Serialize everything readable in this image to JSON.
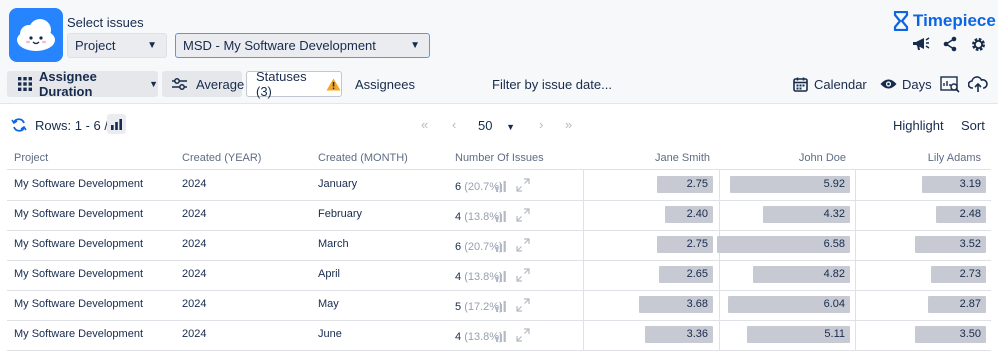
{
  "header": {
    "select_label": "Select issues",
    "scope_select": "Project",
    "project_select": "MSD - My Software Development",
    "brand": "Timepiece"
  },
  "toolbar": {
    "report_type": "Assignee Duration",
    "average": "Average",
    "statuses": "Statuses (3)",
    "assignees": "Assignees",
    "filter_date": "Filter by issue date...",
    "calendar": "Calendar",
    "days": "Days"
  },
  "table_controls": {
    "rows_label": "Rows: 1 - 6 / 6",
    "page_size": "50",
    "highlight": "Highlight",
    "sort": "Sort"
  },
  "columns": [
    "Project",
    "Created (YEAR)",
    "Created (MONTH)",
    "Number Of Issues",
    "Jane Smith",
    "John Doe",
    "Lily Adams"
  ],
  "rows": [
    {
      "project": "My Software Development",
      "year": "2024",
      "month": "January",
      "issues": "6",
      "pct": "(20.7%)",
      "values": [
        "2.75",
        "5.92",
        "3.19"
      ]
    },
    {
      "project": "My Software Development",
      "year": "2024",
      "month": "February",
      "issues": "4",
      "pct": "(13.8%)",
      "values": [
        "2.40",
        "4.32",
        "2.48"
      ]
    },
    {
      "project": "My Software Development",
      "year": "2024",
      "month": "March",
      "issues": "6",
      "pct": "(20.7%)",
      "values": [
        "2.75",
        "6.58",
        "3.52"
      ]
    },
    {
      "project": "My Software Development",
      "year": "2024",
      "month": "April",
      "issues": "4",
      "pct": "(13.8%)",
      "values": [
        "2.65",
        "4.82",
        "2.73"
      ]
    },
    {
      "project": "My Software Development",
      "year": "2024",
      "month": "May",
      "issues": "5",
      "pct": "(17.2%)",
      "values": [
        "3.68",
        "6.04",
        "2.87"
      ]
    },
    {
      "project": "My Software Development",
      "year": "2024",
      "month": "June",
      "issues": "4",
      "pct": "(13.8%)",
      "values": [
        "3.36",
        "5.11",
        "3.50"
      ]
    }
  ],
  "colors": {
    "accent": "#0c66e4",
    "logo_bg": "#2684ff",
    "bar": "#c7cad3",
    "warning": "#f5a623"
  }
}
